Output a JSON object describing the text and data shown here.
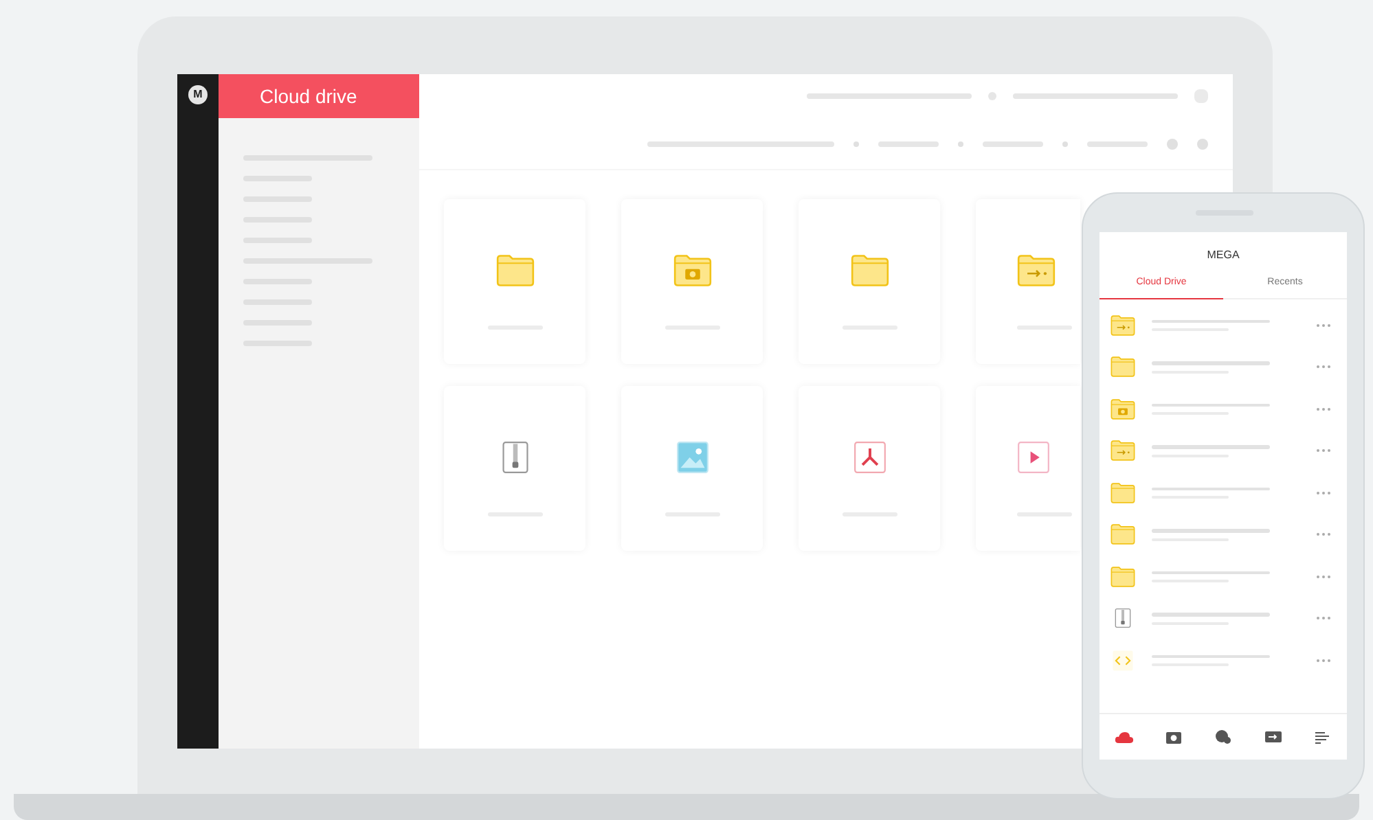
{
  "laptop": {
    "logo_letter": "M",
    "header": {
      "title": "Cloud drive"
    },
    "tiles": [
      {
        "kind": "folder"
      },
      {
        "kind": "camera-folder"
      },
      {
        "kind": "folder"
      },
      {
        "kind": "shared-folder"
      },
      {
        "kind": "zip"
      },
      {
        "kind": "image"
      },
      {
        "kind": "pdf"
      },
      {
        "kind": "video"
      }
    ]
  },
  "phone": {
    "title": "MEGA",
    "tabs": [
      {
        "label": "Cloud Drive",
        "selected": true
      },
      {
        "label": "Recents",
        "selected": false
      }
    ],
    "rows": [
      {
        "kind": "shared-folder"
      },
      {
        "kind": "folder"
      },
      {
        "kind": "camera-folder"
      },
      {
        "kind": "shared-folder"
      },
      {
        "kind": "folder"
      },
      {
        "kind": "folder"
      },
      {
        "kind": "folder"
      },
      {
        "kind": "zip"
      },
      {
        "kind": "code"
      }
    ],
    "nav": [
      {
        "kind": "cloud",
        "selected": true
      },
      {
        "kind": "camera",
        "selected": false
      },
      {
        "kind": "chat",
        "selected": false
      },
      {
        "kind": "shared",
        "selected": false
      },
      {
        "kind": "menu",
        "selected": false
      }
    ]
  }
}
